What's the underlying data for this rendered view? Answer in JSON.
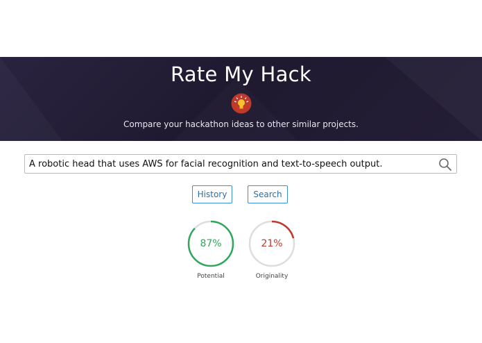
{
  "header": {
    "title": "Rate My Hack",
    "subtitle": "Compare your hackathon ideas to other similar projects.",
    "logo_icon": "lightbulb-icon"
  },
  "search": {
    "value": "A robotic head that uses AWS for facial recognition and text-to-speech output.",
    "icon": "search-icon"
  },
  "buttons": {
    "history_label": "History",
    "search_label": "Search"
  },
  "scores": {
    "potential": {
      "value_text": "87%",
      "fraction": 0.87,
      "label": "Potential",
      "color": "#2ea85a"
    },
    "originality": {
      "value_text": "21%",
      "fraction": 0.21,
      "label": "Originality",
      "color": "#c0392b"
    }
  },
  "colors": {
    "hero_bg": "#221c33",
    "button_border": "#3b8fd0",
    "gauge_track": "#dddddd"
  }
}
